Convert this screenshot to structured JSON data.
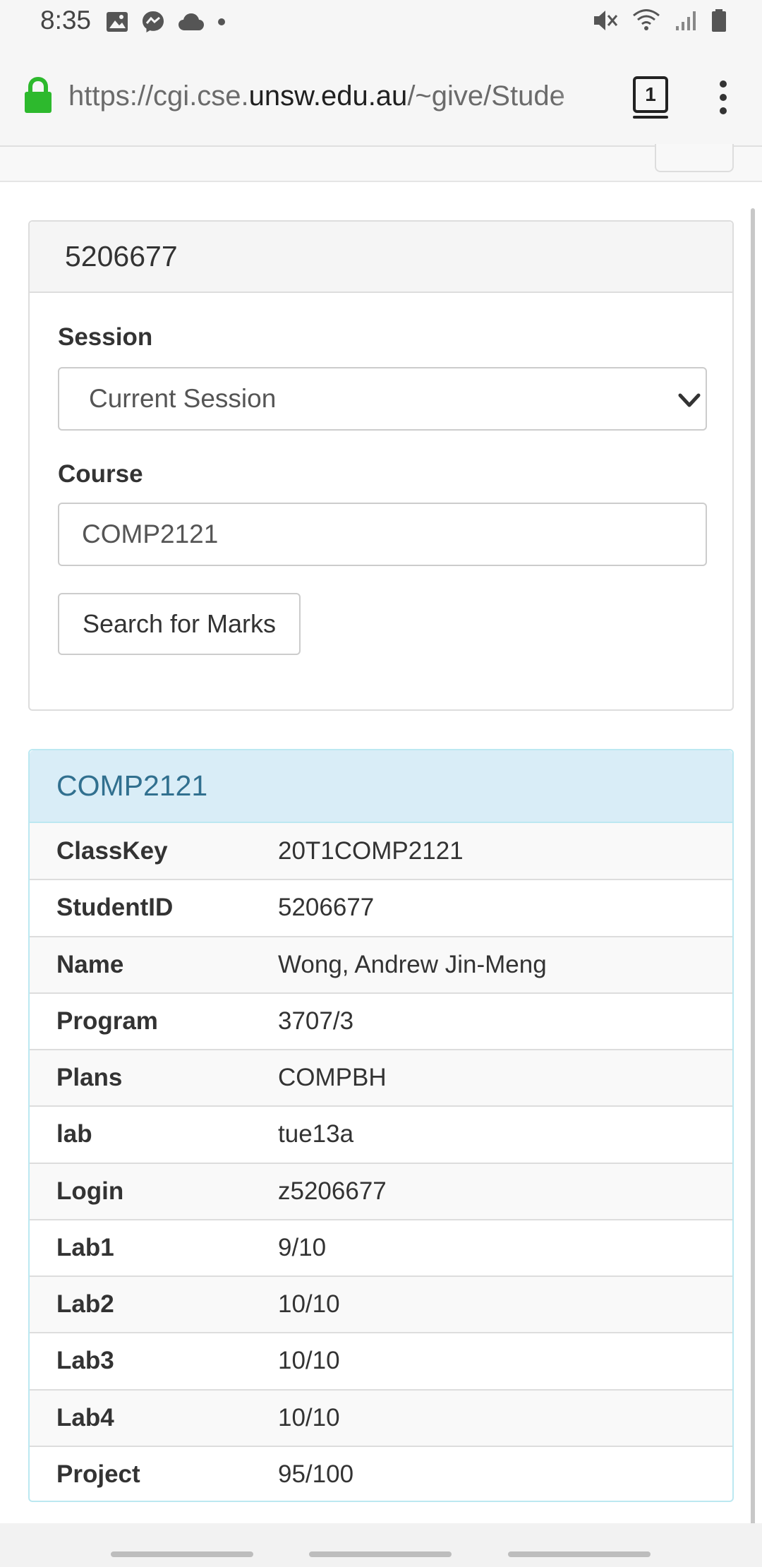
{
  "status_bar": {
    "time": "8:35",
    "left_icons": [
      "image-icon",
      "messenger-icon",
      "cloud-icon",
      "dot-icon"
    ],
    "right_icons": [
      "mute-icon",
      "wifi-icon",
      "signal-icon",
      "battery-icon"
    ]
  },
  "browser": {
    "url_scheme_sub": "https://cgi.cse.",
    "url_host": "unsw.edu.au",
    "url_path": "/~give/Stude",
    "tab_count": "1"
  },
  "search_panel": {
    "title": "5206677",
    "session_label": "Session",
    "session_value": "Current Session",
    "course_label": "Course",
    "course_value": "COMP2121",
    "search_button": "Search for Marks"
  },
  "results": {
    "title": "COMP2121",
    "rows": [
      {
        "key": "ClassKey",
        "value": "20T1COMP2121"
      },
      {
        "key": "StudentID",
        "value": "5206677"
      },
      {
        "key": "Name",
        "value": "Wong, Andrew Jin-Meng"
      },
      {
        "key": "Program",
        "value": "3707/3"
      },
      {
        "key": "Plans",
        "value": "COMPBH"
      },
      {
        "key": "lab",
        "value": "tue13a"
      },
      {
        "key": "Login",
        "value": "z5206677"
      },
      {
        "key": "Lab1",
        "value": "9/10"
      },
      {
        "key": "Lab2",
        "value": "10/10"
      },
      {
        "key": "Lab3",
        "value": "10/10"
      },
      {
        "key": "Lab4",
        "value": "10/10"
      },
      {
        "key": "Project",
        "value": "95/100"
      }
    ]
  },
  "colors": {
    "info_heading_bg": "#d9edf7",
    "info_heading_text": "#31708f",
    "lock_green": "#2db92d"
  }
}
